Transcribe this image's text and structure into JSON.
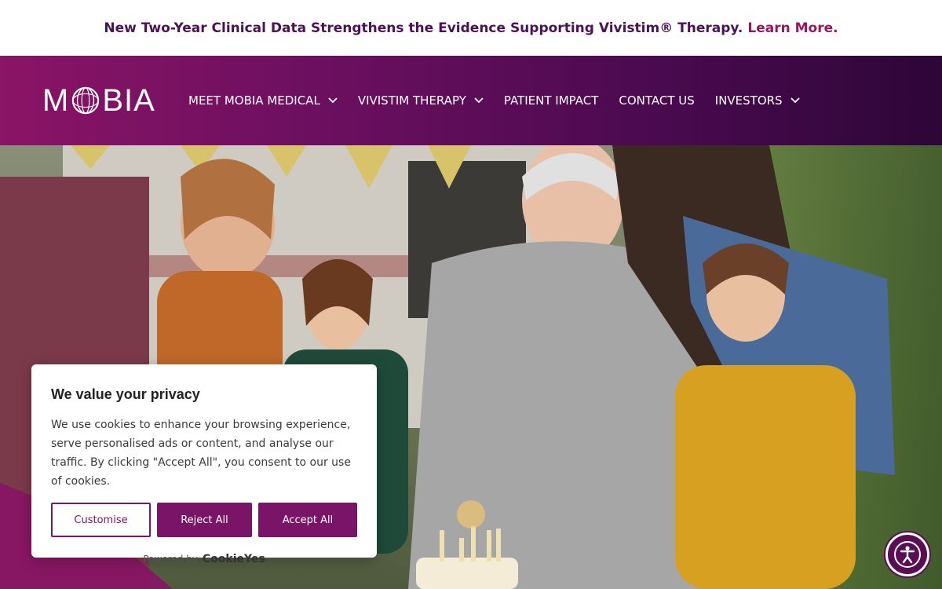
{
  "announcement": {
    "text": "New Two-Year Clinical Data Strengthens the Evidence Supporting Vivistim® Therapy.",
    "link": "Learn More."
  },
  "header": {
    "logo_text_left": "M",
    "logo_text_right": "BIA",
    "nav": [
      {
        "label": "MEET MOBIA MEDICAL",
        "has_dropdown": true
      },
      {
        "label": "VIVISTIM THERAPY",
        "has_dropdown": true
      },
      {
        "label": "PATIENT IMPACT",
        "has_dropdown": false
      },
      {
        "label": "CONTACT US",
        "has_dropdown": false
      },
      {
        "label": "INVESTORS",
        "has_dropdown": true
      }
    ]
  },
  "hero": {
    "image_icon": "family-birthday-photo"
  },
  "cookie_banner": {
    "title": "We value your privacy",
    "body": "We use cookies to enhance your browsing experience, serve personalised ads or content, and analyse our traffic. By clicking \"Accept All\", you consent to our use of cookies.",
    "customise_label": "Customise",
    "reject_label": "Reject All",
    "accept_label": "Accept All",
    "powered_by": "Powered by",
    "powered_brand": "CookieYes"
  },
  "colors": {
    "brand": "#7a1466",
    "announce_text": "#4a1257",
    "link": "#93185e"
  },
  "accessibility_button": {
    "icon": "accessibility-icon"
  }
}
